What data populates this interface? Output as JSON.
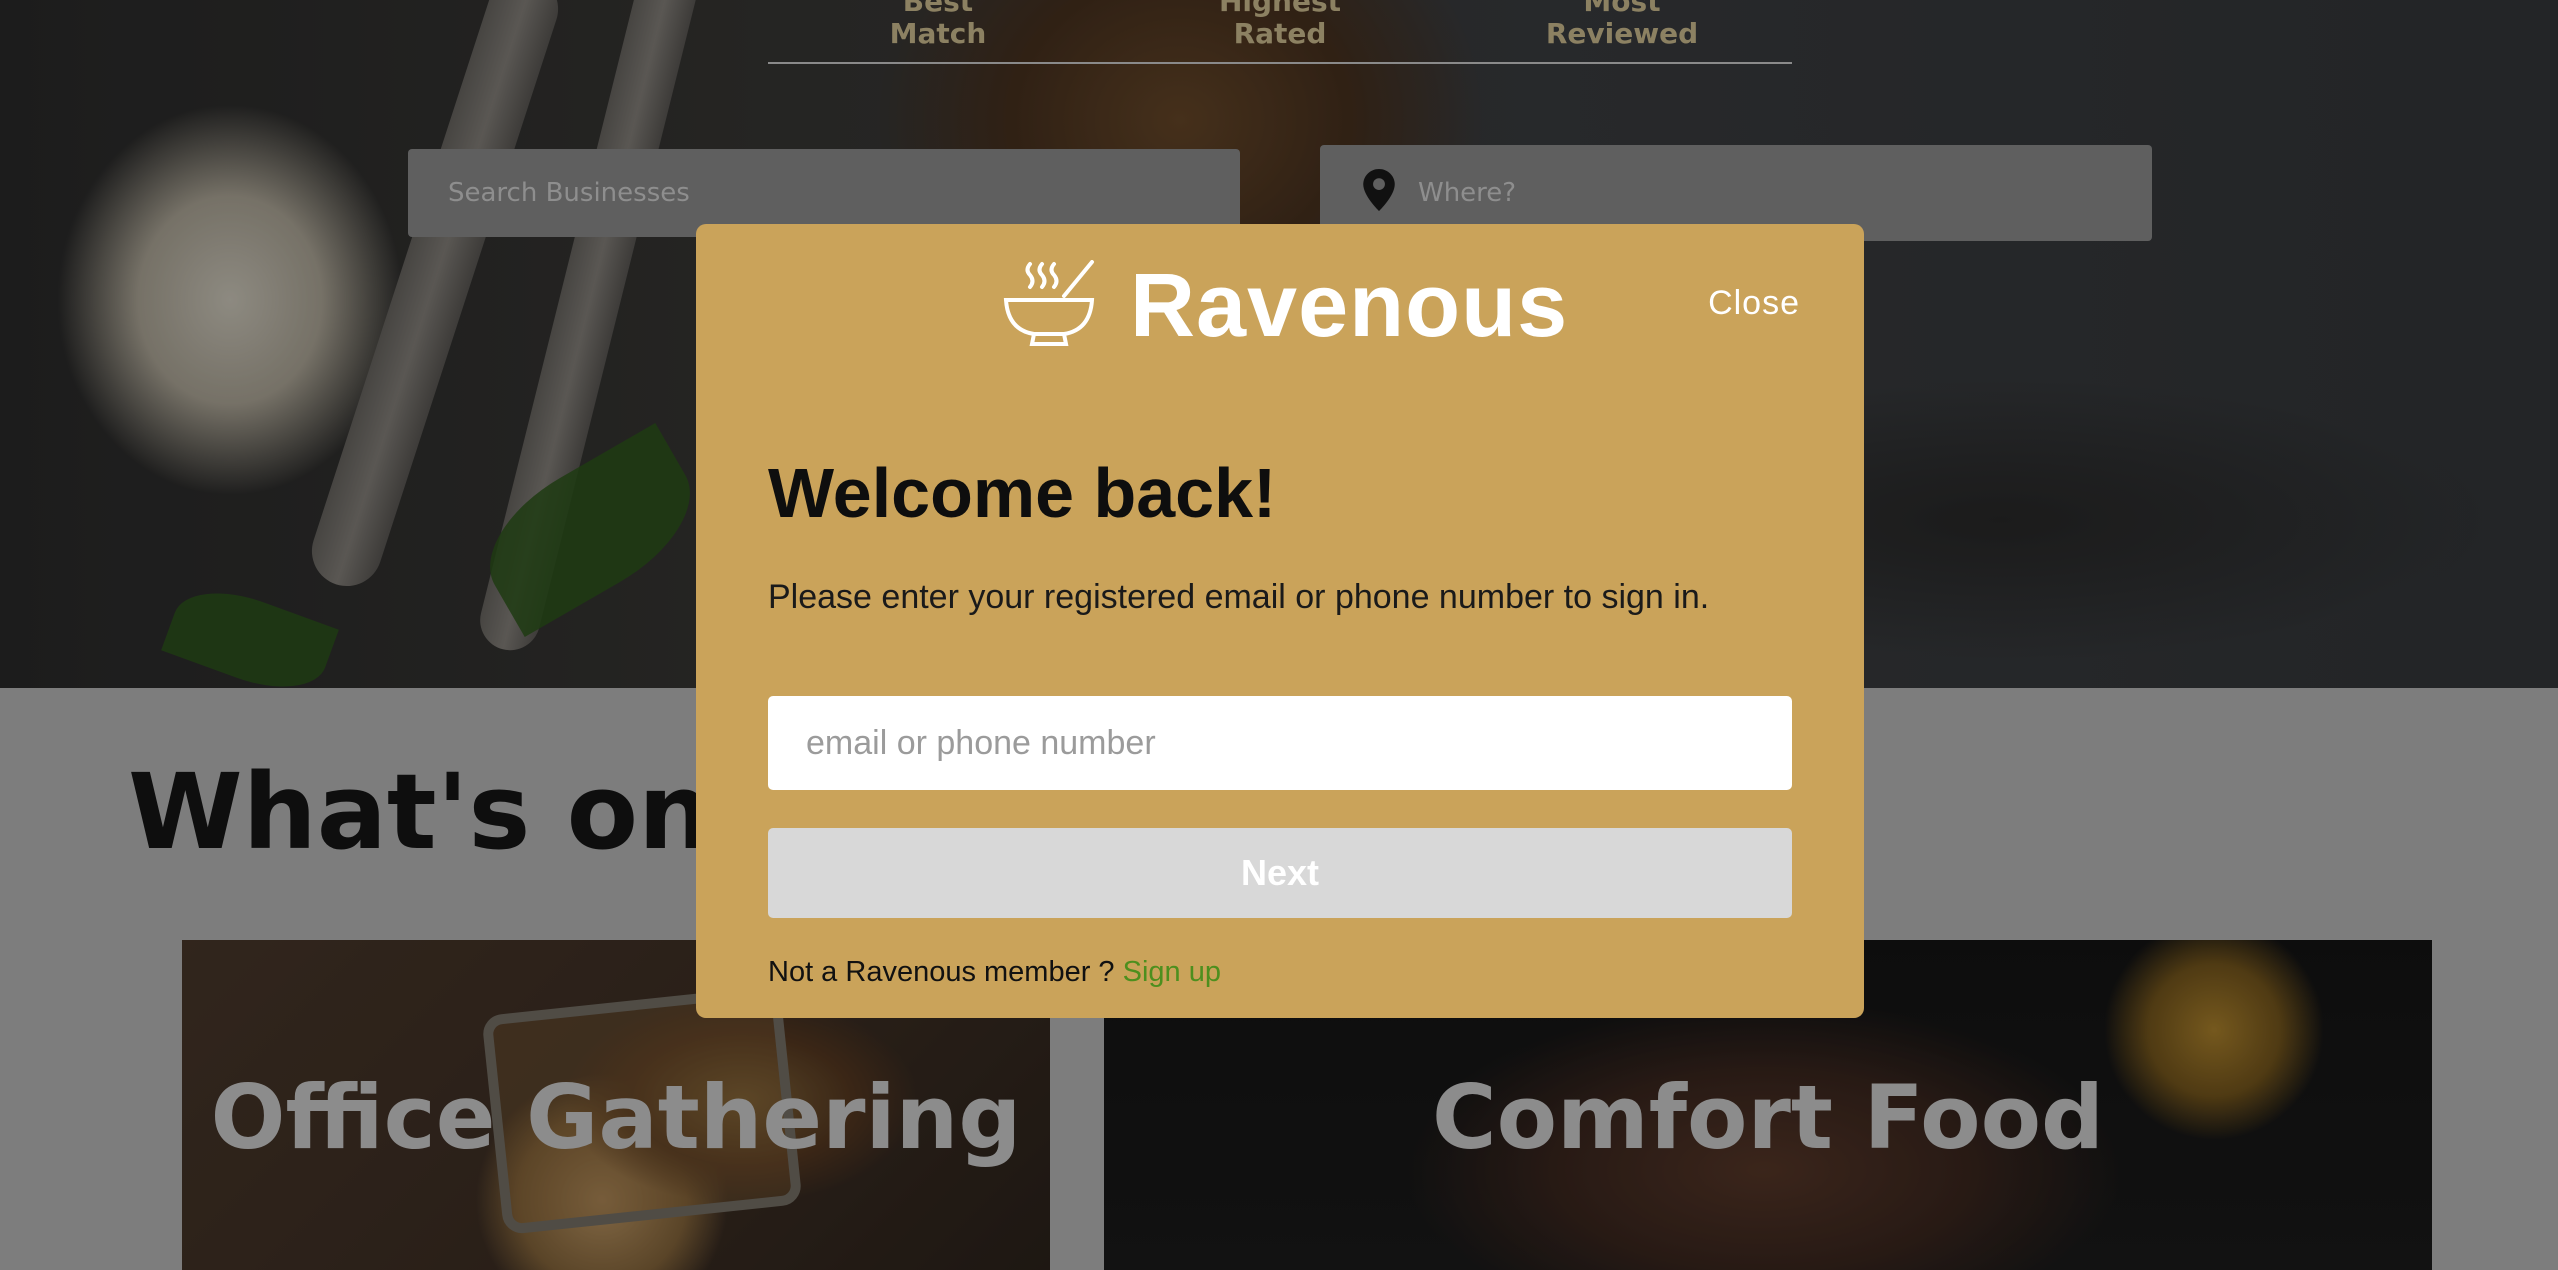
{
  "sort_tabs": [
    {
      "line1": "Best",
      "line2": "Match"
    },
    {
      "line1": "Highest",
      "line2": "Rated"
    },
    {
      "line1": "Most",
      "line2": "Reviewed"
    }
  ],
  "search": {
    "business_placeholder": "Search Businesses",
    "location_placeholder": "Where?"
  },
  "section": {
    "title": "What's on t"
  },
  "cards": [
    {
      "title": "Office Gathering"
    },
    {
      "title": "Comfort Food"
    }
  ],
  "modal": {
    "brand": "Ravenous",
    "close_label": "Close",
    "heading": "Welcome back!",
    "instructions": "Please enter your registered email or phone number to sign in.",
    "input_placeholder": "email or phone number",
    "next_label": "Next",
    "signup_prompt": "Not a Ravenous member ?",
    "signup_link": "Sign up",
    "icons": {
      "logo": "bowl-icon",
      "location": "map-pin-icon"
    }
  },
  "colors": {
    "modal_background": "#caa35a",
    "signup_link": "#4d8f1e",
    "next_button_disabled": "#d8d8d8"
  }
}
